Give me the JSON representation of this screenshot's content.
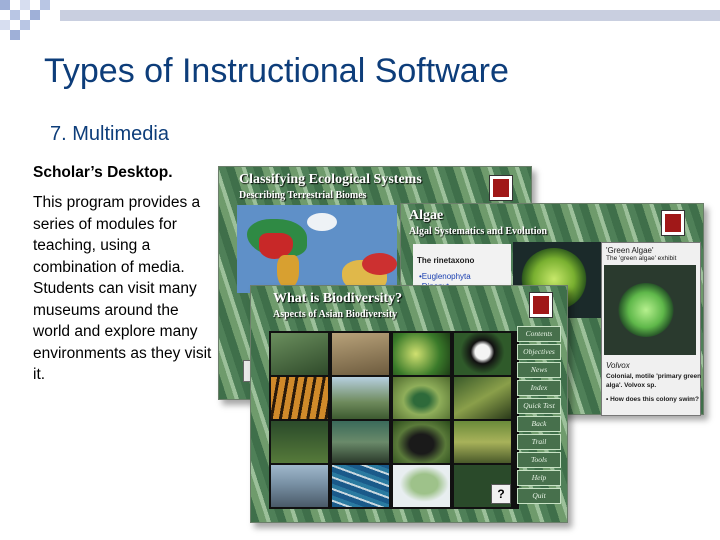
{
  "slide": {
    "title": "Types of Instructional Software",
    "subtitle": "7. Multimedia",
    "lead": "Scholar’s Desktop.",
    "body": "This program provides a series of modules for teaching, using a combination of media. Students can visit many museums around the world and explore many environments as they visit it."
  },
  "screens": {
    "ecological": {
      "title": "Classifying Ecological Systems",
      "subtitle": "Describing Terrestrial Biomes"
    },
    "algae": {
      "title": "Algae",
      "subtitle": "Algal Systematics and Evolution",
      "text_heading": "The rinetaxono",
      "bullet_1": "•Euglenophyta",
      "bullet_2": "•Dinopyt",
      "caption_top": "'Green Algae'",
      "caption_top_2": "The 'green algae' exhibit",
      "volvox_label": "Volvox",
      "volvox_desc_1": "Colonial, motile 'primary green",
      "volvox_desc_2": "alga'. Volvox sp.",
      "question": "• How does this colony swim?"
    },
    "biodiversity": {
      "title": "What is Biodiversity?",
      "subtitle": "Aspects of Asian Biodiversity",
      "help_mark": "?",
      "menu": [
        "Contents",
        "Objectives",
        "News",
        "Index",
        "Quick Test",
        "Back",
        "Trail",
        "Tools",
        "Help",
        "Quit"
      ]
    }
  },
  "colors": {
    "title_blue": "#0d3d7a",
    "deco_square": "#9fb0d8",
    "screen_green": "#4f8058"
  }
}
